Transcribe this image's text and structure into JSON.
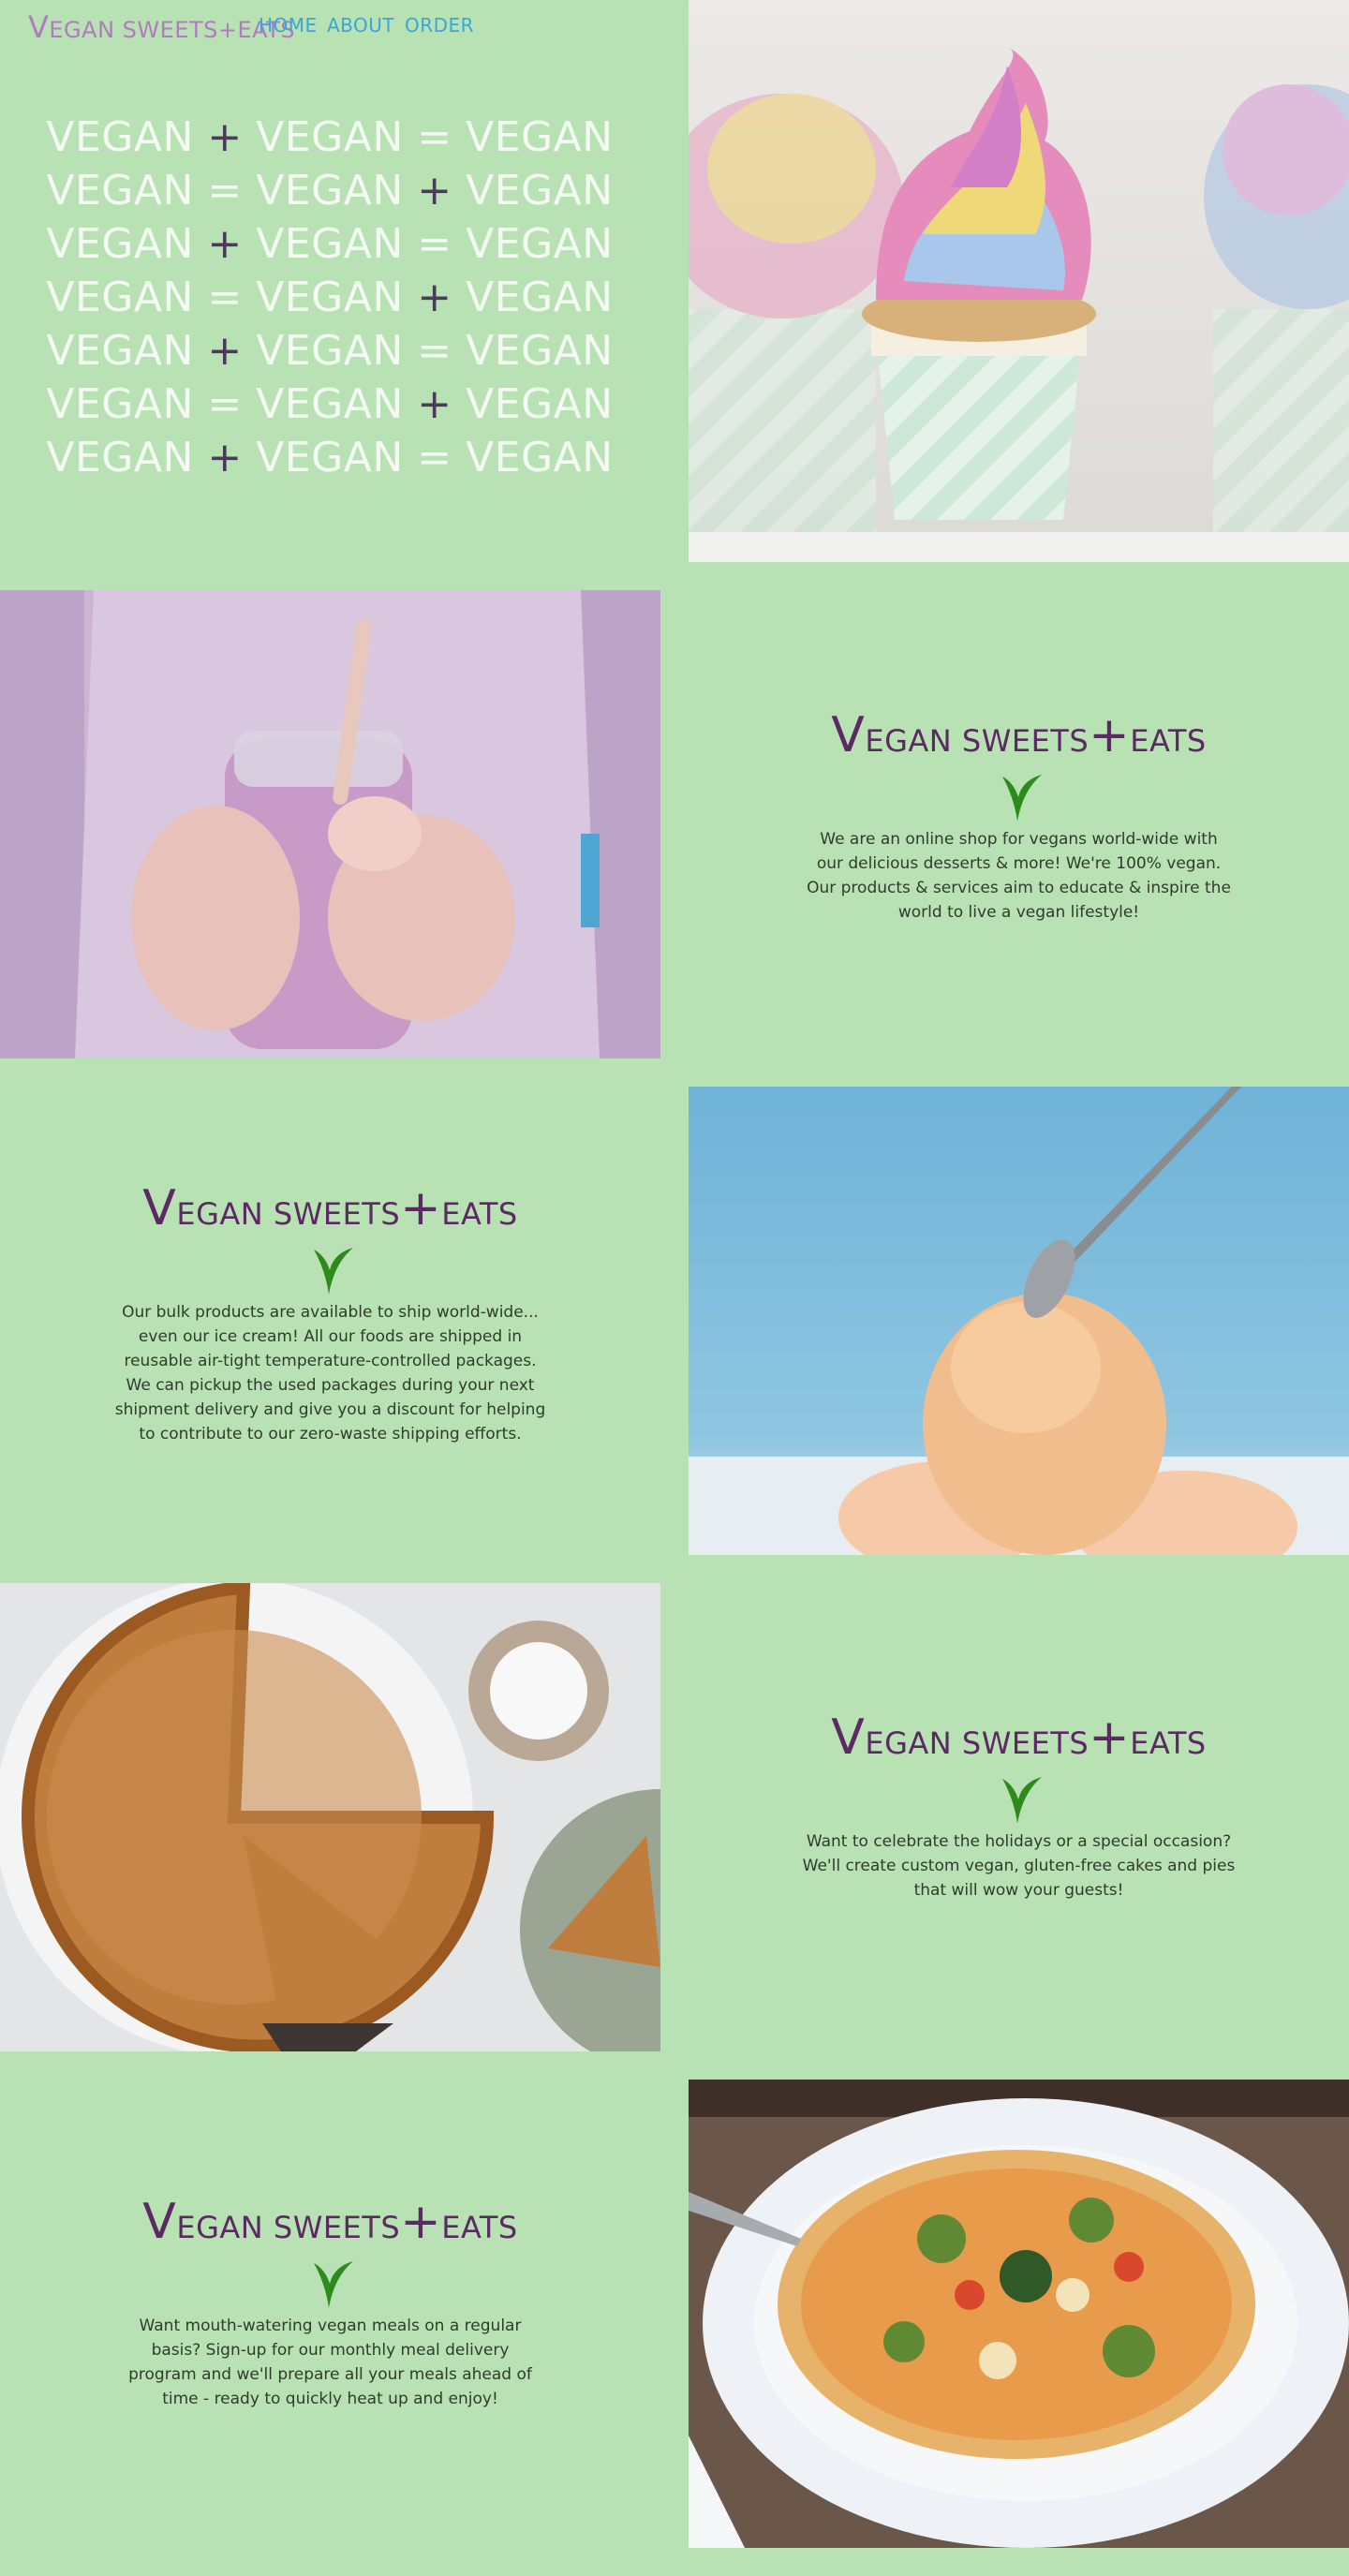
{
  "nav": {
    "brand_initial": "V",
    "brand_rest": "EGAN SWEETS",
    "brand_plus": "+",
    "brand_end": "EATS",
    "links": [
      "HOME",
      "ABOUT",
      "ORDER"
    ]
  },
  "hero": {
    "lines": [
      [
        "VEGAN",
        "+",
        "VEGAN",
        "=",
        "VEGAN"
      ],
      [
        "VEGAN",
        "=",
        "VEGAN",
        "+",
        "VEGAN"
      ],
      [
        "VEGAN",
        "+",
        "VEGAN",
        "=",
        "VEGAN"
      ],
      [
        "VEGAN",
        "=",
        "VEGAN",
        "+",
        "VEGAN"
      ],
      [
        "VEGAN",
        "+",
        "VEGAN",
        "=",
        "VEGAN"
      ],
      [
        "VEGAN",
        "=",
        "VEGAN",
        "+",
        "VEGAN"
      ],
      [
        "VEGAN",
        "+",
        "VEGAN",
        "=",
        "VEGAN"
      ]
    ]
  },
  "title": {
    "initial": "V",
    "rest": "EGAN SWEETS",
    "plus": "+",
    "end": "EATS"
  },
  "sections": [
    {
      "text": "We are an online shop for vegans world-wide with our delicious desserts & more! We're 100% vegan. Our products & services aim to educate & inspire the world to live a vegan lifestyle!"
    },
    {
      "text": "Our bulk products are available to ship world-wide... even our ice cream! All our foods are shipped in reusable air-tight temperature-controlled packages. We can pickup the used packages during your next shipment delivery and give you a discount for helping to contribute to our zero-waste shipping efforts."
    },
    {
      "text": "Want to celebrate the holidays or a special occasion? We'll create custom vegan, gluten-free cakes and pies that will wow your guests!"
    },
    {
      "text": "Want mouth-watering vegan meals on a regular basis? Sign-up for our monthly meal delivery program and we'll prepare all your meals ahead of time - ready to quickly heat up and enjoy!"
    }
  ],
  "colors": {
    "background": "#b9e2b4",
    "brand_nav": "#b07cc0",
    "nav_link": "#3aa6d6",
    "title": "#5b2a62",
    "leaf": "#2f8a1e",
    "hero_text": "#f4fbf3"
  },
  "icons": [
    "leaf-icon"
  ]
}
